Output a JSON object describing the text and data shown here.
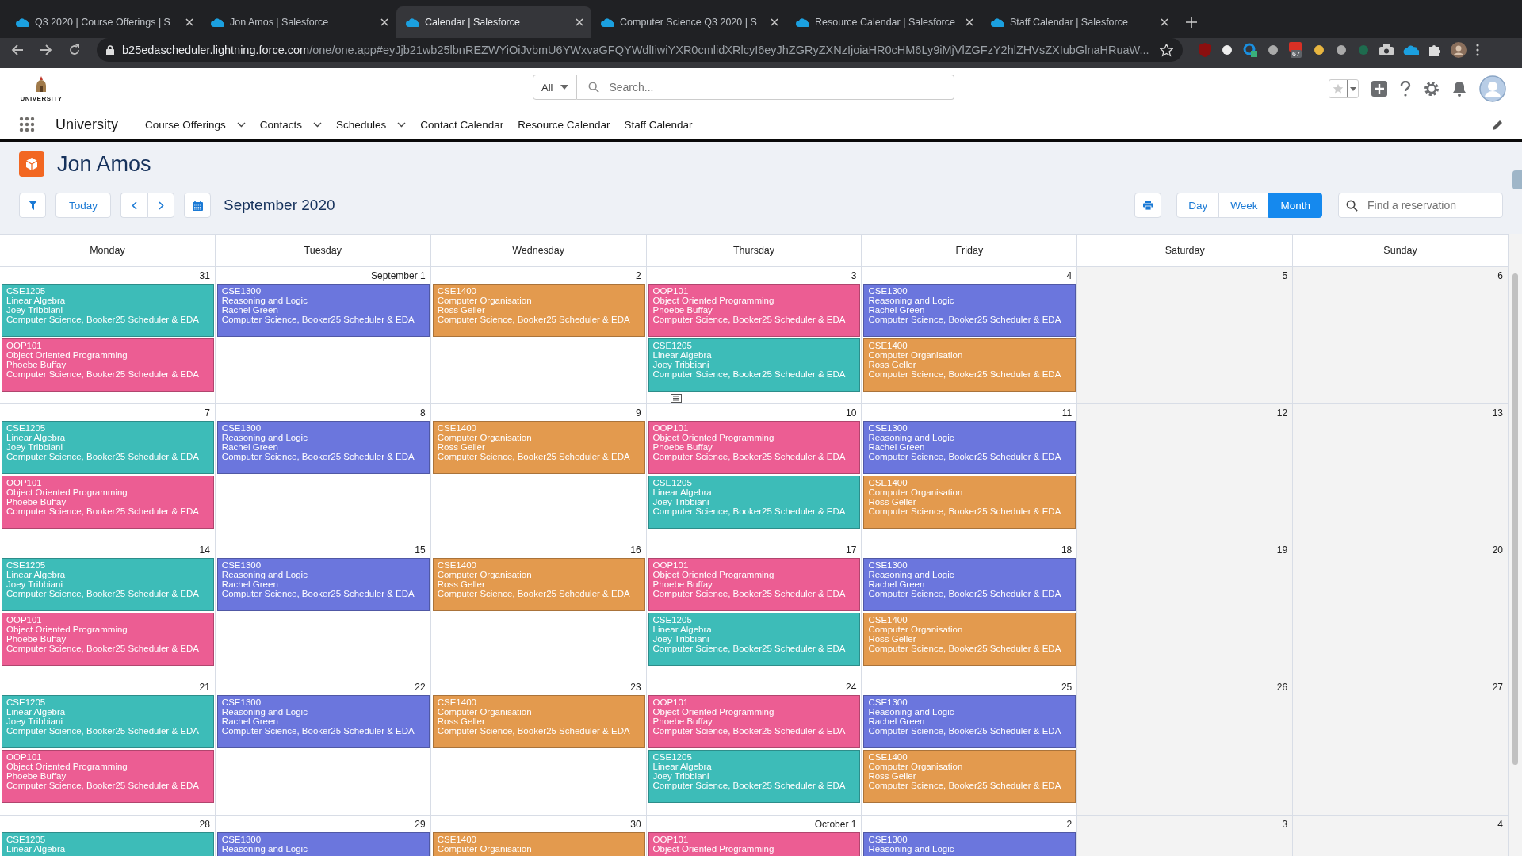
{
  "browser": {
    "tabs": [
      {
        "title": "Q3 2020 | Course Offerings | S",
        "selected": false
      },
      {
        "title": "Jon Amos | Salesforce",
        "selected": false
      },
      {
        "title": "Calendar | Salesforce",
        "selected": true
      },
      {
        "title": "Computer Science Q3 2020 | S",
        "selected": false
      },
      {
        "title": "Resource Calendar | Salesforce",
        "selected": false
      },
      {
        "title": "Staff Calendar | Salesforce",
        "selected": false
      }
    ],
    "url_host": "b25edascheduler.lightning.force.com",
    "url_path": "/one/one.app#eyJjb21wb25lbnREZWYiOiJvbmU6YWxvaGFQYWdlIiwiYXR0cmlidXRlcyI6eyJhZGRyZXNzIjoiaHR0cHM6Ly9iMjVlZGFzY2hlZHVsZXIubGlnaHRuaW...",
    "extension_badge": "67"
  },
  "header": {
    "logo_text": "UNIVERSITY",
    "search_scope": "All",
    "search_placeholder": "Search..."
  },
  "nav": {
    "app_name": "University",
    "items": [
      {
        "label": "Course Offerings",
        "has_menu": true
      },
      {
        "label": "Contacts",
        "has_menu": true
      },
      {
        "label": "Schedules",
        "has_menu": true
      },
      {
        "label": "Contact Calendar",
        "has_menu": false
      },
      {
        "label": "Resource Calendar",
        "has_menu": false
      },
      {
        "label": "Staff Calendar",
        "has_menu": false
      }
    ]
  },
  "page": {
    "title": "Jon Amos",
    "today": "Today",
    "period": "September 2020",
    "views": [
      {
        "label": "Day",
        "selected": false
      },
      {
        "label": "Week",
        "selected": false
      },
      {
        "label": "Month",
        "selected": true
      }
    ],
    "find_placeholder": "Find a reservation"
  },
  "columns": [
    {
      "label": "Monday",
      "weekend": false
    },
    {
      "label": "Tuesday",
      "weekend": false
    },
    {
      "label": "Wednesday",
      "weekend": false
    },
    {
      "label": "Thursday",
      "weekend": false
    },
    {
      "label": "Friday",
      "weekend": false
    },
    {
      "label": "Saturday",
      "weekend": true
    },
    {
      "label": "Sunday",
      "weekend": true
    }
  ],
  "weeks": [
    {
      "days": [
        {
          "date": "31",
          "events": [
            {
              "code": "CSE1205",
              "title": "Linear Algebra",
              "person": "Joey Tribbiani",
              "location": "Computer Science, Booker25 Scheduler & EDA",
              "color": "#3dbcb8"
            },
            {
              "code": "OOP101",
              "title": "Object Oriented Programming",
              "person": "Phoebe Buffay",
              "location": "Computer Science, Booker25 Scheduler & EDA",
              "color": "#ec5d93"
            }
          ]
        },
        {
          "date": "September 1",
          "events": [
            {
              "code": "CSE1300",
              "title": "Reasoning and Logic",
              "person": "Rachel Green",
              "location": "Computer Science, Booker25 Scheduler & EDA",
              "color": "#6b76dd"
            }
          ]
        },
        {
          "date": "2",
          "events": [
            {
              "code": "CSE1400",
              "title": "Computer Organisation",
              "person": "Ross Geller",
              "location": "Computer Science, Booker25 Scheduler & EDA",
              "color": "#e39a4e"
            }
          ]
        },
        {
          "date": "3",
          "events": [
            {
              "code": "OOP101",
              "title": "Object Oriented Programming",
              "person": "Phoebe Buffay",
              "location": "Computer Science, Booker25 Scheduler & EDA",
              "color": "#ec5d93"
            },
            {
              "code": "CSE1205",
              "title": "Linear Algebra",
              "person": "Joey Tribbiani",
              "location": "Computer Science, Booker25 Scheduler & EDA",
              "color": "#3dbcb8"
            }
          ]
        },
        {
          "date": "4",
          "events": [
            {
              "code": "CSE1300",
              "title": "Reasoning and Logic",
              "person": "Rachel Green",
              "location": "Computer Science, Booker25 Scheduler & EDA",
              "color": "#6b76dd"
            },
            {
              "code": "CSE1400",
              "title": "Computer Organisation",
              "person": "Ross Geller",
              "location": "Computer Science, Booker25 Scheduler & EDA",
              "color": "#e39a4e"
            }
          ]
        },
        {
          "date": "5"
        },
        {
          "date": "6"
        }
      ]
    },
    {
      "days": [
        {
          "date": "7",
          "events": [
            {
              "code": "CSE1205",
              "title": "Linear Algebra",
              "person": "Joey Tribbiani",
              "location": "Computer Science, Booker25 Scheduler & EDA",
              "color": "#3dbcb8"
            },
            {
              "code": "OOP101",
              "title": "Object Oriented Programming",
              "person": "Phoebe Buffay",
              "location": "Computer Science, Booker25 Scheduler & EDA",
              "color": "#ec5d93"
            }
          ]
        },
        {
          "date": "8",
          "events": [
            {
              "code": "CSE1300",
              "title": "Reasoning and Logic",
              "person": "Rachel Green",
              "location": "Computer Science, Booker25 Scheduler & EDA",
              "color": "#6b76dd"
            }
          ]
        },
        {
          "date": "9",
          "events": [
            {
              "code": "CSE1400",
              "title": "Computer Organisation",
              "person": "Ross Geller",
              "location": "Computer Science, Booker25 Scheduler & EDA",
              "color": "#e39a4e"
            }
          ]
        },
        {
          "date": "10",
          "events": [
            {
              "code": "OOP101",
              "title": "Object Oriented Programming",
              "person": "Phoebe Buffay",
              "location": "Computer Science, Booker25 Scheduler & EDA",
              "color": "#ec5d93"
            },
            {
              "code": "CSE1205",
              "title": "Linear Algebra",
              "person": "Joey Tribbiani",
              "location": "Computer Science, Booker25 Scheduler & EDA",
              "color": "#3dbcb8"
            }
          ]
        },
        {
          "date": "11",
          "events": [
            {
              "code": "CSE1300",
              "title": "Reasoning and Logic",
              "person": "Rachel Green",
              "location": "Computer Science, Booker25 Scheduler & EDA",
              "color": "#6b76dd"
            },
            {
              "code": "CSE1400",
              "title": "Computer Organisation",
              "person": "Ross Geller",
              "location": "Computer Science, Booker25 Scheduler & EDA",
              "color": "#e39a4e"
            }
          ]
        },
        {
          "date": "12"
        },
        {
          "date": "13"
        }
      ]
    },
    {
      "days": [
        {
          "date": "14",
          "events": [
            {
              "code": "CSE1205",
              "title": "Linear Algebra",
              "person": "Joey Tribbiani",
              "location": "Computer Science, Booker25 Scheduler & EDA",
              "color": "#3dbcb8"
            },
            {
              "code": "OOP101",
              "title": "Object Oriented Programming",
              "person": "Phoebe Buffay",
              "location": "Computer Science, Booker25 Scheduler & EDA",
              "color": "#ec5d93"
            }
          ]
        },
        {
          "date": "15",
          "events": [
            {
              "code": "CSE1300",
              "title": "Reasoning and Logic",
              "person": "Rachel Green",
              "location": "Computer Science, Booker25 Scheduler & EDA",
              "color": "#6b76dd"
            }
          ]
        },
        {
          "date": "16",
          "events": [
            {
              "code": "CSE1400",
              "title": "Computer Organisation",
              "person": "Ross Geller",
              "location": "Computer Science, Booker25 Scheduler & EDA",
              "color": "#e39a4e"
            }
          ]
        },
        {
          "date": "17",
          "events": [
            {
              "code": "OOP101",
              "title": "Object Oriented Programming",
              "person": "Phoebe Buffay",
              "location": "Computer Science, Booker25 Scheduler & EDA",
              "color": "#ec5d93"
            },
            {
              "code": "CSE1205",
              "title": "Linear Algebra",
              "person": "Joey Tribbiani",
              "location": "Computer Science, Booker25 Scheduler & EDA",
              "color": "#3dbcb8"
            }
          ]
        },
        {
          "date": "18",
          "events": [
            {
              "code": "CSE1300",
              "title": "Reasoning and Logic",
              "person": "Rachel Green",
              "location": "Computer Science, Booker25 Scheduler & EDA",
              "color": "#6b76dd"
            },
            {
              "code": "CSE1400",
              "title": "Computer Organisation",
              "person": "Ross Geller",
              "location": "Computer Science, Booker25 Scheduler & EDA",
              "color": "#e39a4e"
            }
          ]
        },
        {
          "date": "19"
        },
        {
          "date": "20"
        }
      ]
    },
    {
      "days": [
        {
          "date": "21",
          "events": [
            {
              "code": "CSE1205",
              "title": "Linear Algebra",
              "person": "Joey Tribbiani",
              "location": "Computer Science, Booker25 Scheduler & EDA",
              "color": "#3dbcb8"
            },
            {
              "code": "OOP101",
              "title": "Object Oriented Programming",
              "person": "Phoebe Buffay",
              "location": "Computer Science, Booker25 Scheduler & EDA",
              "color": "#ec5d93"
            }
          ]
        },
        {
          "date": "22",
          "events": [
            {
              "code": "CSE1300",
              "title": "Reasoning and Logic",
              "person": "Rachel Green",
              "location": "Computer Science, Booker25 Scheduler & EDA",
              "color": "#6b76dd"
            }
          ]
        },
        {
          "date": "23",
          "events": [
            {
              "code": "CSE1400",
              "title": "Computer Organisation",
              "person": "Ross Geller",
              "location": "Computer Science, Booker25 Scheduler & EDA",
              "color": "#e39a4e"
            }
          ]
        },
        {
          "date": "24",
          "events": [
            {
              "code": "OOP101",
              "title": "Object Oriented Programming",
              "person": "Phoebe Buffay",
              "location": "Computer Science, Booker25 Scheduler & EDA",
              "color": "#ec5d93"
            },
            {
              "code": "CSE1205",
              "title": "Linear Algebra",
              "person": "Joey Tribbiani",
              "location": "Computer Science, Booker25 Scheduler & EDA",
              "color": "#3dbcb8"
            }
          ]
        },
        {
          "date": "25",
          "events": [
            {
              "code": "CSE1300",
              "title": "Reasoning and Logic",
              "person": "Rachel Green",
              "location": "Computer Science, Booker25 Scheduler & EDA",
              "color": "#6b76dd"
            },
            {
              "code": "CSE1400",
              "title": "Computer Organisation",
              "person": "Ross Geller",
              "location": "Computer Science, Booker25 Scheduler & EDA",
              "color": "#e39a4e"
            }
          ]
        },
        {
          "date": "26"
        },
        {
          "date": "27"
        }
      ]
    },
    {
      "days": [
        {
          "date": "28",
          "events": [
            {
              "code": "CSE1205",
              "title": "Linear Algebra",
              "color": "#3dbcb8"
            }
          ]
        },
        {
          "date": "29",
          "events": [
            {
              "code": "CSE1300",
              "title": "Reasoning and Logic",
              "color": "#6b76dd"
            }
          ]
        },
        {
          "date": "30",
          "events": [
            {
              "code": "CSE1400",
              "title": "Computer Organisation",
              "color": "#e39a4e"
            }
          ]
        },
        {
          "date": "October 1",
          "events": [
            {
              "code": "OOP101",
              "title": "Object Oriented Programming",
              "color": "#ec5d93"
            }
          ]
        },
        {
          "date": "2",
          "events": [
            {
              "code": "CSE1300",
              "title": "Reasoning and Logic",
              "color": "#6b76dd"
            }
          ]
        },
        {
          "date": "3"
        },
        {
          "date": "4"
        }
      ]
    }
  ]
}
